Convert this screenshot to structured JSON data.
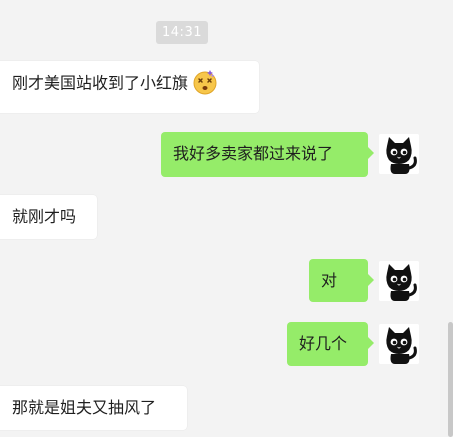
{
  "timestamp": "14:31",
  "messages": [
    {
      "side": "incoming",
      "text": "刚才美国站收到了小红旗",
      "emoji": "dizzy-face-emoji"
    },
    {
      "side": "outgoing",
      "text": "我好多卖家都过来说了",
      "avatar": "black-cat-avatar"
    },
    {
      "side": "incoming",
      "text": "就刚才吗"
    },
    {
      "side": "outgoing",
      "text": "对",
      "avatar": "black-cat-avatar"
    },
    {
      "side": "outgoing",
      "text": "好几个",
      "avatar": "black-cat-avatar"
    },
    {
      "side": "incoming",
      "text": "那就是姐夫又抽风了"
    }
  ],
  "colors": {
    "background": "#f3f3f3",
    "incoming_bubble": "#ffffff",
    "outgoing_bubble": "#95ec69",
    "timestamp_bg": "#dadada"
  }
}
